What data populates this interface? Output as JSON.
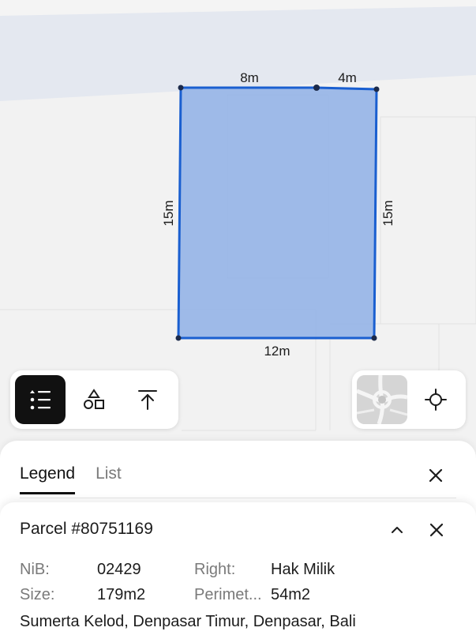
{
  "map": {
    "dimensions": {
      "top_left": "8m",
      "top_right": "4m",
      "left": "15m",
      "right": "15m",
      "bottom": "12m"
    },
    "colors": {
      "parcel_fill": "#8fb0e6",
      "parcel_stroke": "#1a5fd0",
      "road": "#e4e8f0",
      "background": "#f2f2f2"
    }
  },
  "toolbar": {
    "icons": [
      "legend-list-icon",
      "shapes-icon",
      "upload-icon"
    ]
  },
  "map_controls": {
    "icons": [
      "basemap-thumbnail",
      "crosshair-icon"
    ]
  },
  "sheet": {
    "tabs": [
      {
        "label": "Legend",
        "active": true
      },
      {
        "label": "List",
        "active": false
      }
    ]
  },
  "parcel": {
    "title": "Parcel #80751169",
    "nib_label": "NiB:",
    "nib_value": "02429",
    "right_label": "Right:",
    "right_value": "Hak Milik",
    "size_label": "Size:",
    "size_value": "179m2",
    "perimeter_label": "Perimet...",
    "perimeter_value": "54m2",
    "address": "Sumerta Kelod, Denpasar Timur, Denpasar, Bali"
  }
}
